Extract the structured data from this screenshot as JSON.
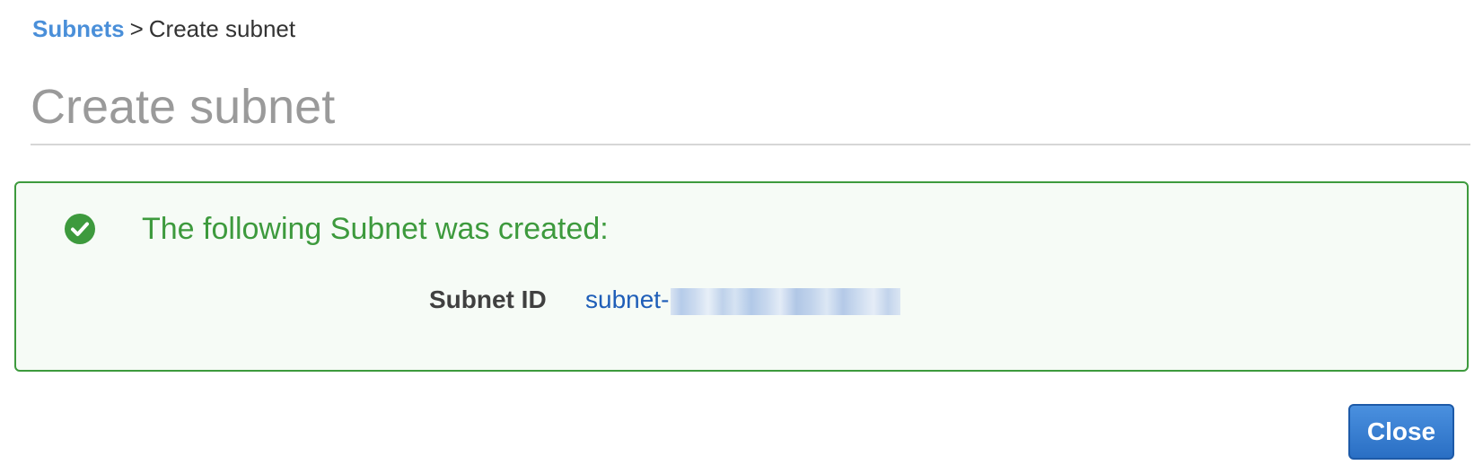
{
  "breadcrumb": {
    "parent": "Subnets",
    "separator": ">",
    "current": "Create subnet"
  },
  "page": {
    "title": "Create subnet"
  },
  "alert": {
    "type": "success",
    "icon": "check-circle-icon",
    "heading": "The following Subnet was created:",
    "details": [
      {
        "label": "Subnet ID",
        "value": "subnet-",
        "value_redacted": true
      }
    ]
  },
  "actions": {
    "close_label": "Close"
  },
  "colors": {
    "link": "#4a8fd9",
    "success": "#3d9a3d",
    "success_bg": "#f6fbf6",
    "id_link": "#1f5eb8",
    "primary_button": "#2a6fc4",
    "title_gray": "#9a9a9a"
  }
}
